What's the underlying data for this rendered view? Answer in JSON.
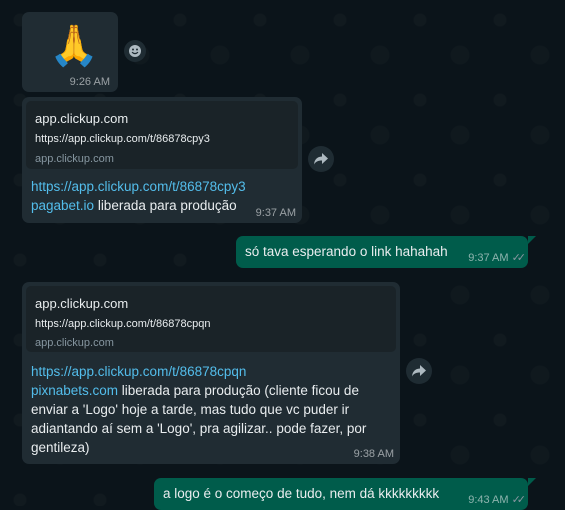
{
  "messages": [
    {
      "emoji": "🙏",
      "time": "9:26 AM"
    },
    {
      "preview": {
        "title": "app.clickup.com",
        "url": "https://app.clickup.com/t/86878cpy3",
        "domain": "app.clickup.com"
      },
      "link": "https://app.clickup.com/t/86878cpy3",
      "site": "pagabet.io",
      "text": " liberada para produção",
      "time": "9:37 AM"
    },
    {
      "text": "só tava esperando o link hahahah",
      "time": "9:37 AM"
    },
    {
      "preview": {
        "title": "app.clickup.com",
        "url": "https://app.clickup.com/t/86878cpqn",
        "domain": "app.clickup.com"
      },
      "link": "https://app.clickup.com/t/86878cpqn",
      "site": "pixnabets.com",
      "text_lines": [
        " liberada para produção (cliente ficou de",
        "enviar a 'Logo' hoje a tarde, mas tudo que vc puder ir",
        "adiantando aí sem a 'Logo', pra agilizar.. pode fazer, por",
        "gentileza)"
      ],
      "time": "9:38 AM"
    },
    {
      "text": "a logo é o começo de tudo, nem dá kkkkkkkkk",
      "time": "9:43 AM"
    }
  ],
  "icons": {
    "forward": "forward-icon",
    "emoji": "smiley-icon",
    "read": "double-check-icon"
  },
  "colors": {
    "incoming": "#202c33",
    "outgoing": "#005c4b",
    "link": "#53bdeb",
    "background": "#0b141a"
  }
}
